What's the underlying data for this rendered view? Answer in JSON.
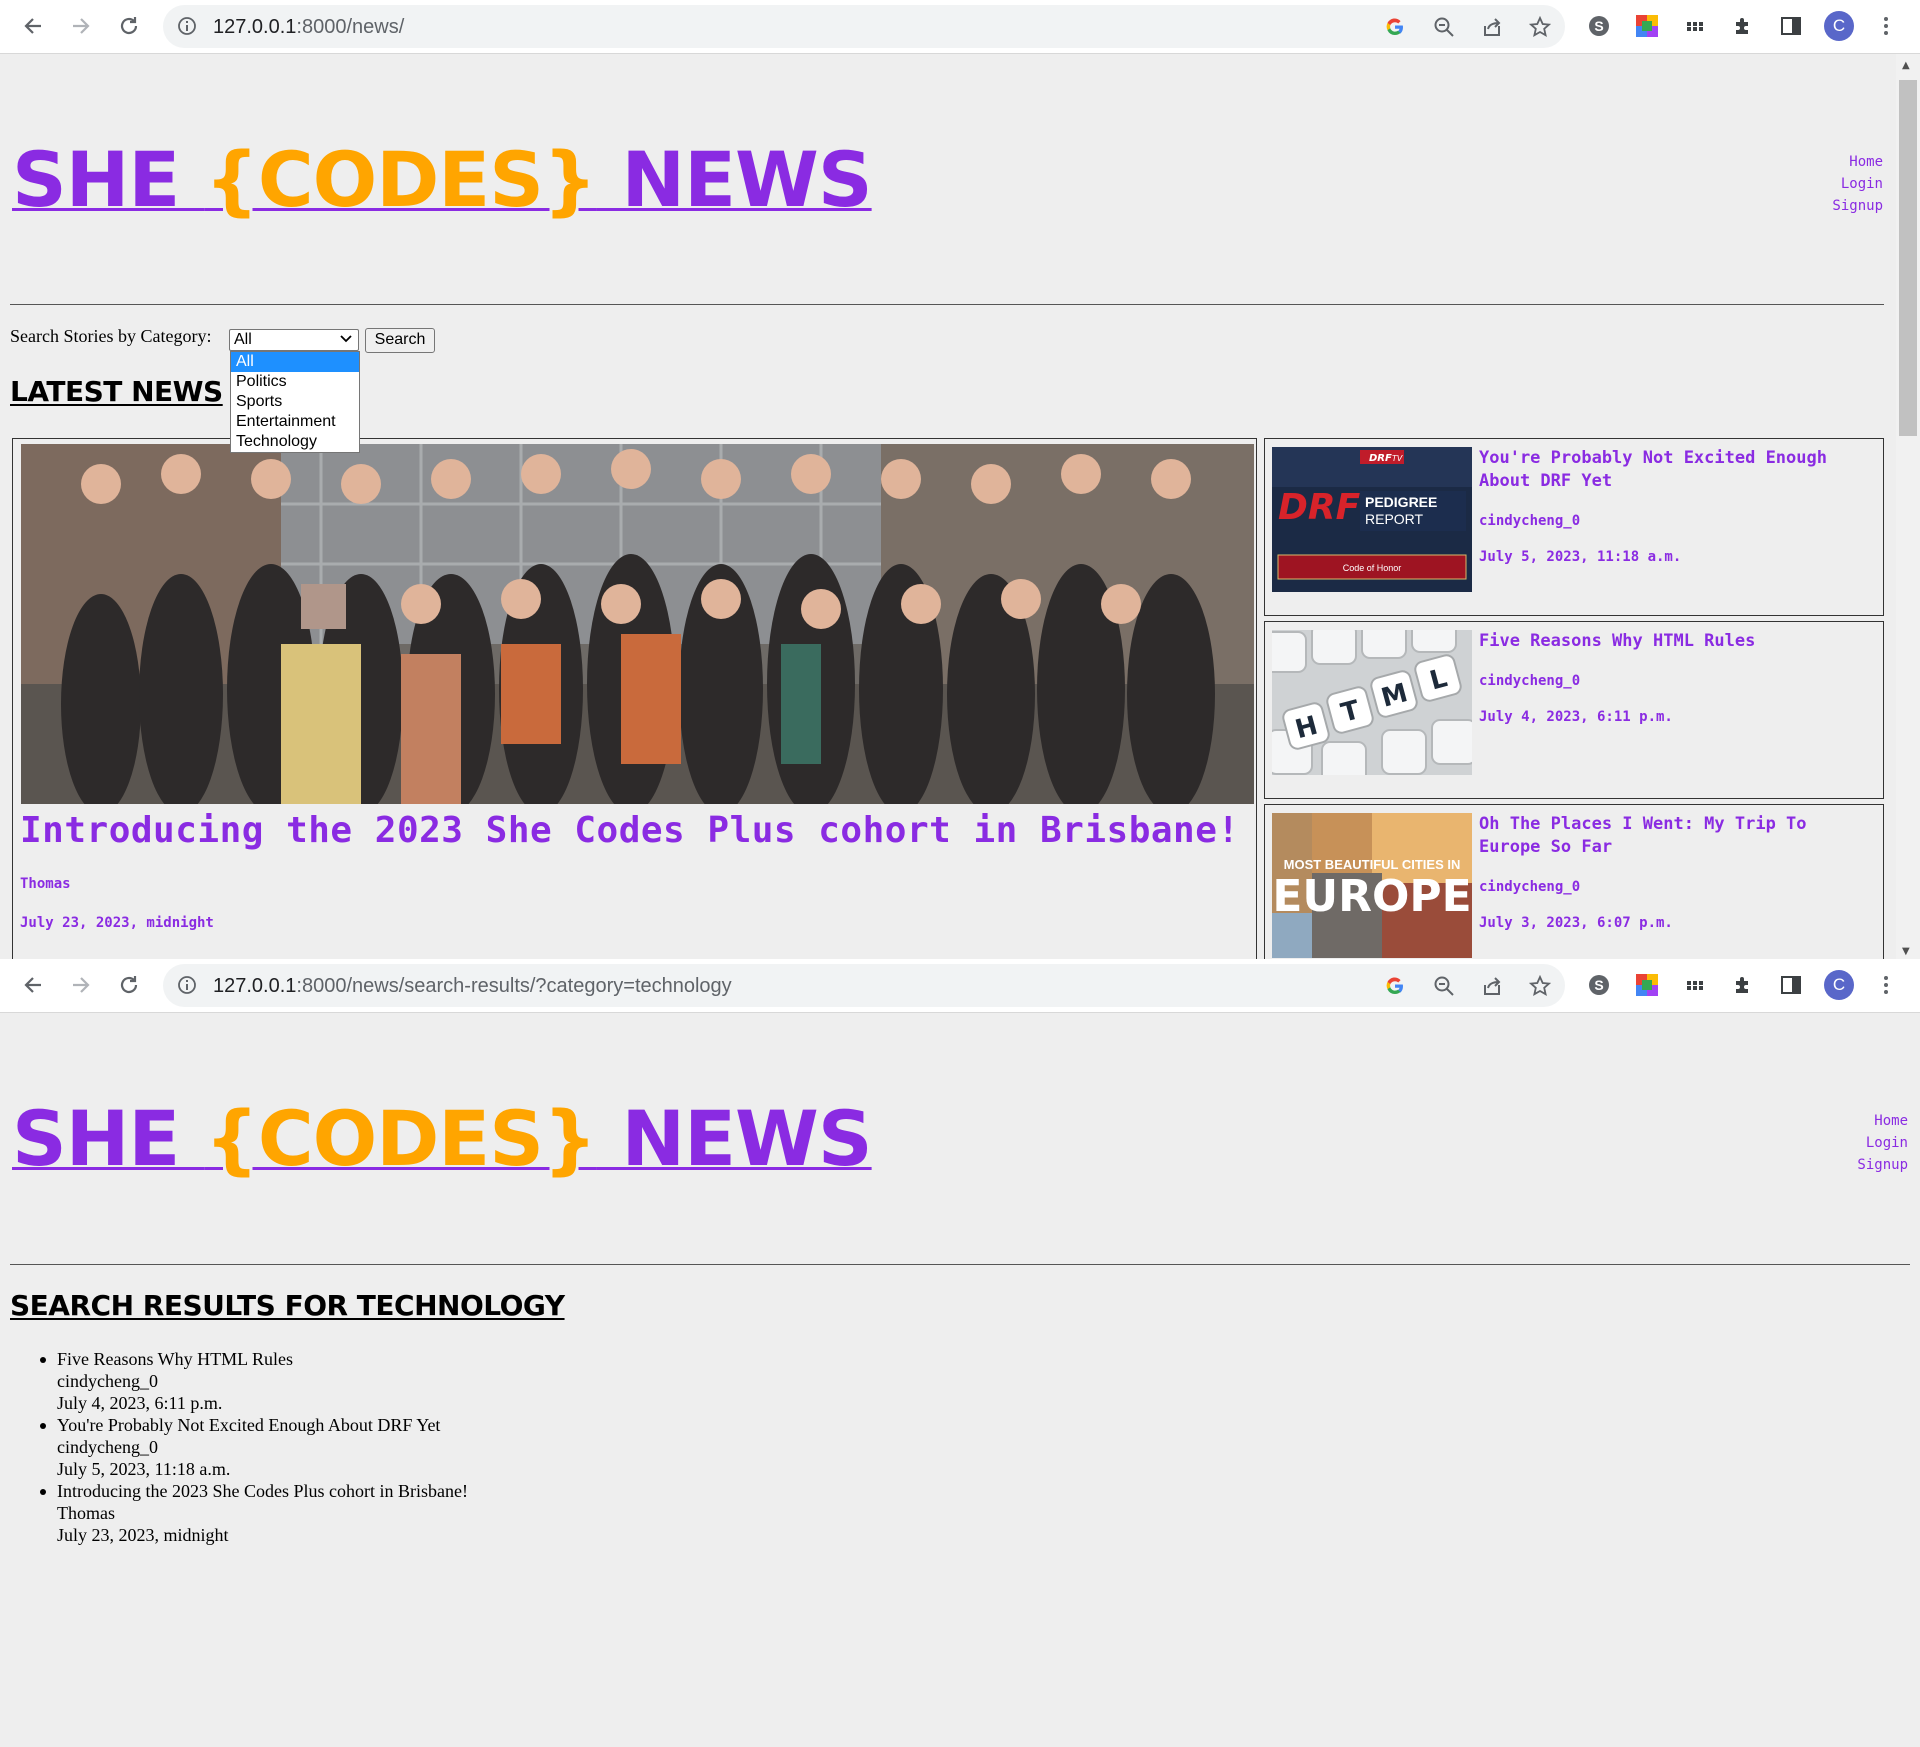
{
  "window1": {
    "url_host": "127.0.0.1",
    "url_rest": ":8000/news/",
    "logo": {
      "part1": "SHE ",
      "part2": "{CODES}",
      "part3": " NEWS"
    },
    "nav": [
      "Home",
      "Login",
      "Signup"
    ],
    "search": {
      "label": "Search Stories by Category:",
      "selected": "All",
      "button": "Search",
      "options": [
        "All",
        "Politics",
        "Sports",
        "Entertainment",
        "Technology"
      ]
    },
    "section_title": "LATEST NEWS",
    "featured": {
      "title": "Introducing the 2023 She Codes Plus cohort in Brisbane!",
      "author": "Thomas",
      "date": "July 23, 2023, midnight"
    },
    "cards": [
      {
        "title": "You're Probably Not Excited Enough About DRF Yet",
        "author": "cindycheng_0",
        "date": "July 5, 2023, 11:18 a.m.",
        "image_text": [
          "DRF",
          "TV",
          "PEDIGREE",
          "REPORT",
          "Code of Honor"
        ]
      },
      {
        "title": "Five Reasons Why HTML Rules",
        "author": "cindycheng_0",
        "date": "July 4, 2023, 6:11 p.m.",
        "image_text": [
          "H",
          "T",
          "M",
          "L"
        ]
      },
      {
        "title": "Oh The Places I Went: My Trip To Europe So Far",
        "author": "cindycheng_0",
        "date": "July 3, 2023, 6:07 p.m.",
        "image_text": [
          "MOST BEAUTIFUL CITIES IN",
          "EUROPE"
        ]
      }
    ]
  },
  "window2": {
    "url_host": "127.0.0.1",
    "url_rest": ":8000/news/search-results/?category=technology",
    "logo": {
      "part1": "SHE ",
      "part2": "{CODES}",
      "part3": " NEWS"
    },
    "nav": [
      "Home",
      "Login",
      "Signup"
    ],
    "section_title": "SEARCH RESULTS FOR TECHNOLOGY",
    "results": [
      {
        "title": "Five Reasons Why HTML Rules",
        "author": "cindycheng_0",
        "date": "July 4, 2023, 6:11 p.m."
      },
      {
        "title": "You're Probably Not Excited Enough About DRF Yet",
        "author": "cindycheng_0",
        "date": "July 5, 2023, 11:18 a.m."
      },
      {
        "title": "Introducing the 2023 She Codes Plus cohort in Brisbane!",
        "author": "Thomas",
        "date": "July 23, 2023, midnight"
      }
    ]
  },
  "browser": {
    "avatar_letter": "C"
  },
  "colors": {
    "accent": "#8a2be2",
    "brand_orange": "#ffa500",
    "page_bg": "#eeeeee",
    "select_highlight": "#1e90ff"
  }
}
